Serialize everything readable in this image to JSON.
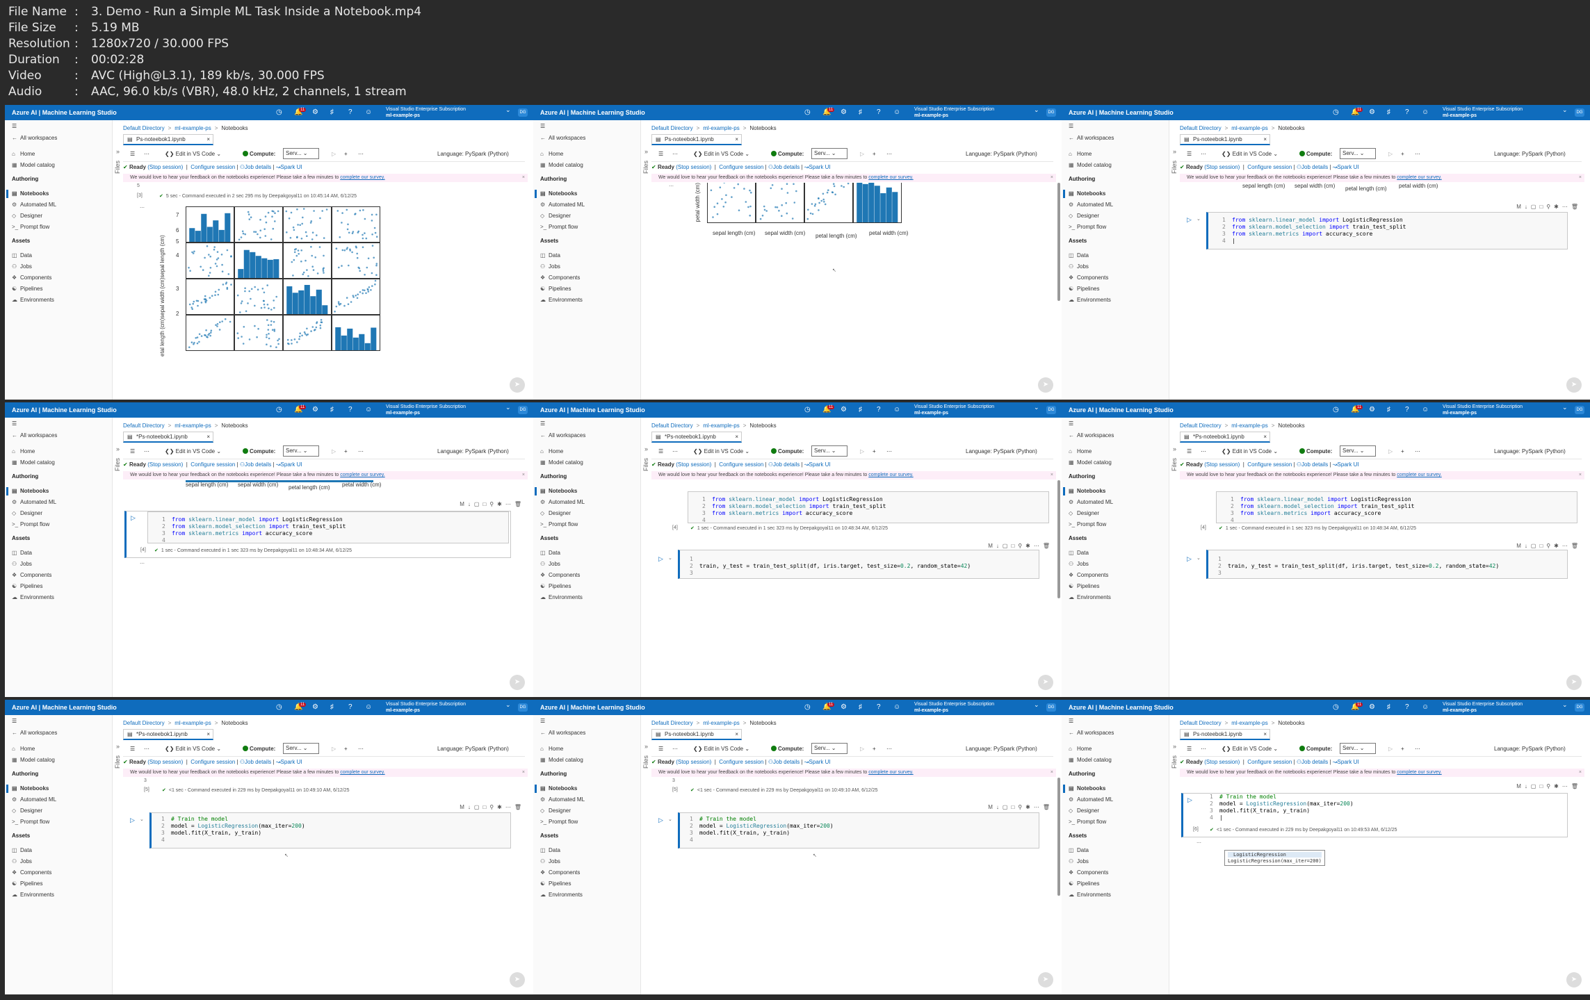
{
  "info": {
    "rows": [
      {
        "k": "File Name",
        "v": "3. Demo - Run a Simple ML Task Inside a Notebook.mp4"
      },
      {
        "k": "File Size",
        "v": "5.19 MB"
      },
      {
        "k": "Resolution",
        "v": "1280x720 / 30.000 FPS"
      },
      {
        "k": "Duration",
        "v": "00:02:28"
      },
      {
        "k": "Video",
        "v": "AVC (High@L3.1), 189 kb/s, 30.000 FPS"
      },
      {
        "k": "Audio",
        "v": "AAC, 96.0 kb/s (VBR), 48.0 kHz, 2 channels, 1 stream"
      }
    ],
    "sep": ":"
  },
  "studio": {
    "brand": "Azure AI | Machine Learning Studio",
    "notif_count": "11",
    "subscription": "Visual Studio Enterprise Subscription",
    "workspace": "ml-example-ps",
    "avatar": "DG",
    "all_workspaces": "All workspaces",
    "home": "Home",
    "model_catalog": "Model catalog",
    "authoring": "Authoring",
    "notebooks": "Notebooks",
    "automated_ml": "Automated ML",
    "designer": "Designer",
    "prompt_flow": "Prompt flow",
    "assets": "Assets",
    "data": "Data",
    "jobs": "Jobs",
    "components": "Components",
    "pipelines": "Pipelines",
    "environments": "Environments",
    "files": "Files",
    "bc_default": "Default Directory",
    "bc_ws": "ml-example-ps",
    "bc_nb": "Notebooks",
    "tab_saved": "Ps-noteebok1.ipynb",
    "tab_unsaved": "*Ps-noteebok1.ipynb",
    "edit_vscode": "Edit in VS Code",
    "compute": "Compute:",
    "compute_val": "Serv...",
    "language": "Language: PySpark (Python)",
    "ready": "Ready",
    "stop_session": "(Stop session)",
    "configure": "Configure session",
    "job_details": "Job details",
    "spark_ui": "Spark UI",
    "banner_text": "We would love to hear your feedback on the notebooks experience! Please take a few minutes to",
    "banner_link": "complete our survey."
  },
  "code": {
    "imp1a": "from",
    "imp1b": "sklearn.linear_model",
    "imp1c": "import",
    "imp1d": "LogisticRegression",
    "imp2a": "from",
    "imp2b": "sklearn.model_selection",
    "imp2c": "import",
    "imp2d": "train_test_split",
    "imp3a": "from",
    "imp3b": "sklearn.metrics",
    "imp3c": "import",
    "imp3d": "accuracy_score",
    "split_a": "train, y_test = ",
    "split_b": "train_test_split",
    "split_c": "(df, iris.target, test_size=",
    "split_d": "0.2",
    "split_e": ", random_state=",
    "split_f": "42",
    "split_g": ")",
    "train_c": "# Train the model",
    "train_a": "model = ",
    "train_b": "LogisticRegression",
    "train_d": "(max_iter=",
    "train_e": "200",
    "train_f": ")",
    "fit_a": "model.",
    "fit_b": "fit",
    "fit_c": "(X_train, y_train)"
  },
  "exec": {
    "e3": "5 sec - Command executed in 2 sec 295 ms by Deepakgoyal11 on 10:45:14 AM, 6/12/25",
    "e4": "1 sec - Command executed in 1 sec 323 ms by Deepakgoyal11 on 10:48:34 AM, 6/12/25",
    "e5": "<1 sec - Command executed in 229 ms by Deepakgoyal11 on 10:49:10 AM, 6/12/25",
    "e6": "<1 sec - Command executed in 229 ms by Deepakgoyal11 on 10:49:53 AM, 6/12/25",
    "l3": "[3]",
    "l4": "[4]",
    "l5": "[5]",
    "l6": "[6]",
    "n5": "5"
  },
  "axes": {
    "sl": "sepal length (cm)",
    "sw": "sepal width (cm)",
    "pl": "petal length (cm)",
    "pw": "petal width (cm)",
    "y_sl": "sepal length (cm)",
    "y_sw": "sepal width (cm)",
    "y_pl": "petal length (cm)",
    "y_pw": "petal width (cm)",
    "t7": "7",
    "t6": "6",
    "t5": "5",
    "t4": "4",
    "t3": "3",
    "t2": "2",
    "t45": "4.5"
  },
  "popup": {
    "head": "LogisticRegression",
    "body": "LogisticRegression(max_iter=200)"
  },
  "colors": {
    "accent": "#0f6cbd",
    "plot": "#1f77b4"
  }
}
